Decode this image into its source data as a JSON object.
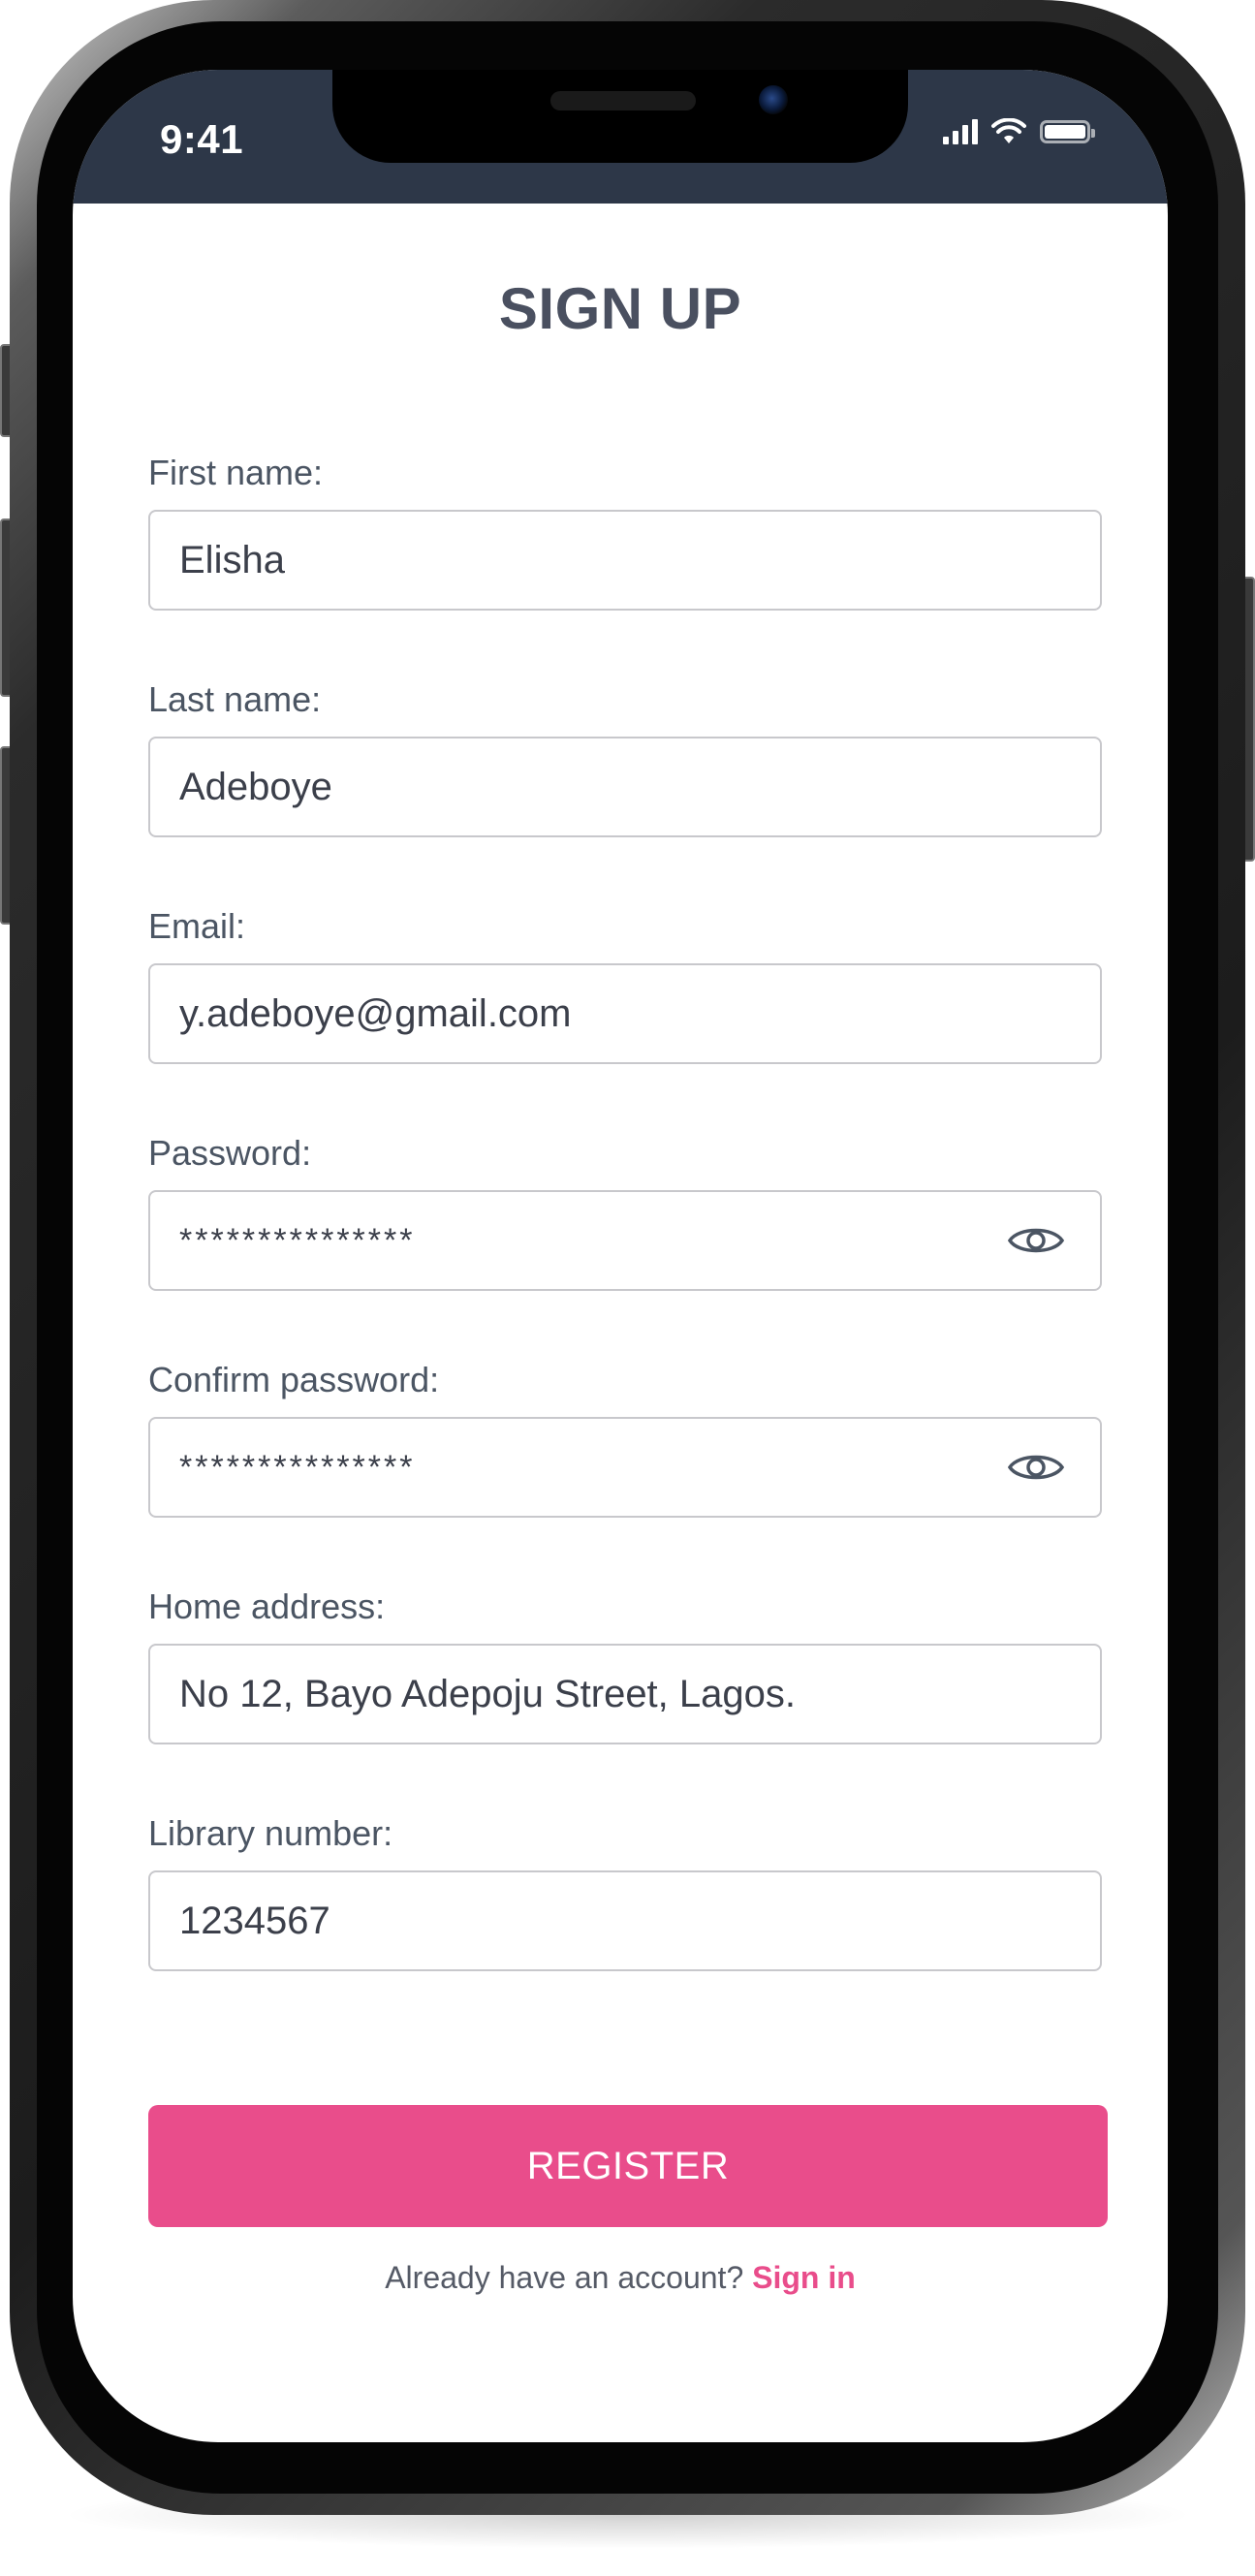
{
  "status_bar": {
    "time": "9:41"
  },
  "page": {
    "title": "SIGN UP"
  },
  "form": {
    "first_name": {
      "label": "First name:",
      "value": "Elisha"
    },
    "last_name": {
      "label": "Last name:",
      "value": "Adeboye"
    },
    "email": {
      "label": "Email:",
      "value": "y.adeboye@gmail.com"
    },
    "password": {
      "label": "Password:",
      "value": "***************"
    },
    "confirm_password": {
      "label": "Confirm password:",
      "value": "***************"
    },
    "home_address": {
      "label": "Home address:",
      "value": "No 12, Bayo Adepoju Street, Lagos."
    },
    "library_number": {
      "label": "Library number:",
      "value": "1234567"
    }
  },
  "actions": {
    "register_label": "REGISTER",
    "signin_prompt": "Already have an account?",
    "signin_link": "Sign in"
  },
  "colors": {
    "accent": "#e94d8b",
    "status_bar": "#2d3748",
    "title": "#4a5060"
  },
  "icons": {
    "password_toggle": "eye-icon",
    "signal": "signal-icon",
    "wifi": "wifi-icon",
    "battery": "battery-icon"
  }
}
